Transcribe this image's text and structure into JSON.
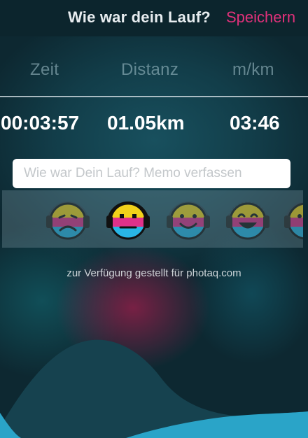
{
  "header": {
    "title": "Wie war dein Lauf?",
    "save_label": "Speichern"
  },
  "stats": {
    "time_label": "Zeit",
    "distance_label": "Distanz",
    "pace_label": "m/km",
    "time_value": "00:03:57",
    "distance_value": "01.05km",
    "pace_value": "03:46"
  },
  "memo": {
    "placeholder": "Wie war Dein Lauf? Memo verfassen",
    "value": ""
  },
  "moods": [
    {
      "icon": "sad-headphones-face-icon",
      "selected": false
    },
    {
      "icon": "neutral-headphones-face-icon",
      "selected": true
    },
    {
      "icon": "smile-headphones-face-icon",
      "selected": false
    },
    {
      "icon": "happy-headphones-face-icon",
      "selected": false
    },
    {
      "icon": "partial-headphones-face-icon",
      "selected": false
    }
  ],
  "watermark": "zur Verfügung gestellt für photaq.com",
  "colors": {
    "accent": "#e0317a",
    "face_yellow": "#f2d21a",
    "face_magenta": "#e0318a",
    "face_cyan": "#29b6e6",
    "wave_dark": "#16424f",
    "wave_light": "#2aa4c8"
  }
}
